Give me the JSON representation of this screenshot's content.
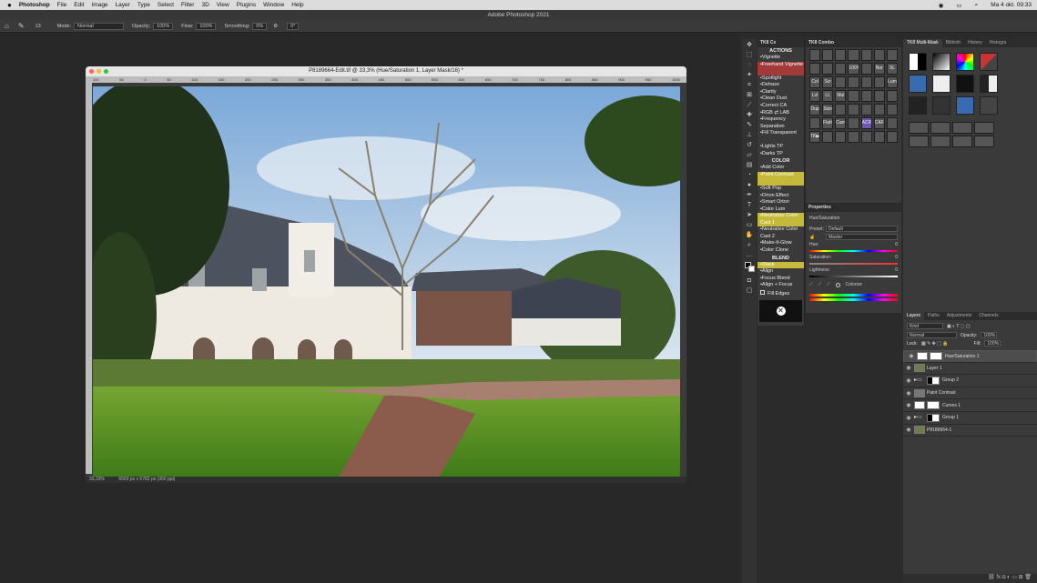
{
  "menubar": {
    "app": "Photoshop",
    "items": [
      "File",
      "Edit",
      "Image",
      "Layer",
      "Type",
      "Select",
      "Filter",
      "3D",
      "View",
      "Plugins",
      "Window",
      "Help"
    ],
    "clock": "Ma 4 okt. 09:33"
  },
  "window_title": "Adobe Photoshop 2021",
  "options": {
    "mode_label": "Mode:",
    "mode": "Normal",
    "opacity_label": "Opacity:",
    "opacity": "100%",
    "flow_label": "Flow:",
    "flow": "100%",
    "smoothing_label": "Smoothing:",
    "smoothing": "0%",
    "angle": "0°",
    "brush_size": "13"
  },
  "document": {
    "title": "P8189664-Edit.tif @ 33,3% (Hue/Saturation 1, Layer Mask/16) *",
    "zoom": "33,33%",
    "info": "6569 px x 5782 px (300 ppi)",
    "ruler": [
      "100",
      "50",
      "0",
      "50",
      "100",
      "150",
      "200",
      "250",
      "300",
      "350",
      "400",
      "450",
      "500",
      "550",
      "600",
      "650",
      "700",
      "750",
      "800",
      "850",
      "900",
      "950",
      "1000"
    ]
  },
  "actions_panel": {
    "tab": "TK8 Cx",
    "sections": [
      {
        "title": "ACTIONS",
        "items": [
          {
            "label": "•Vignette",
            "bg": ""
          },
          {
            "label": "•Freehand Vignette",
            "bg": "#a23a3a"
          },
          {
            "label": "•Spotlight",
            "bg": ""
          },
          {
            "label": "•Dehaze",
            "bg": ""
          },
          {
            "label": "•Clarity",
            "bg": ""
          },
          {
            "label": "•Clean Dust",
            "bg": ""
          },
          {
            "label": "•Correct CA",
            "bg": ""
          },
          {
            "label": "•RGB ⇄ LAB",
            "bg": ""
          },
          {
            "label": "•Frequency Separation",
            "bg": ""
          },
          {
            "label": "•Fill Transparent",
            "bg": ""
          },
          {
            "label": "•Lights TP",
            "bg": ""
          },
          {
            "label": "•Darks TP",
            "bg": ""
          }
        ]
      },
      {
        "title": "COLOR",
        "items": [
          {
            "label": "•Add Color",
            "bg": ""
          },
          {
            "label": "•Paint Contrast",
            "bg": "#c4b93a"
          },
          {
            "label": "•Soft Pop",
            "bg": ""
          },
          {
            "label": "•Orton Effect",
            "bg": ""
          },
          {
            "label": "•Smart Orton",
            "bg": ""
          },
          {
            "label": "•Color Lum",
            "bg": ""
          },
          {
            "label": "•Neutralize Color Cast 1",
            "bg": "#c4b93a"
          },
          {
            "label": "•Neutralize Color Cast 2",
            "bg": ""
          },
          {
            "label": "•Make-It-Glow",
            "bg": ""
          },
          {
            "label": "•Color Clone",
            "bg": ""
          }
        ]
      },
      {
        "title": "BLEND",
        "items": [
          {
            "label": "•Stack",
            "bg": "#c4b93a"
          },
          {
            "label": "•Align",
            "bg": ""
          },
          {
            "label": "•Focus Blend",
            "bg": ""
          },
          {
            "label": "•Align + Focus",
            "bg": ""
          }
        ]
      }
    ],
    "fill_edges": "Fill Edges"
  },
  "combo_panel": {
    "tab": "TK8 Combo",
    "buttons": [
      "",
      "",
      "",
      "",
      "",
      "",
      "",
      "",
      "",
      "",
      "100%",
      "",
      "Nor",
      "SL",
      "Col",
      "Scr",
      "",
      "",
      "",
      "",
      "Lum",
      "Lvl",
      "LL",
      "Mul",
      "",
      "",
      "",
      "",
      "Dup Img",
      "Size",
      "",
      "",
      "",
      "",
      "",
      "",
      "Flatten",
      "Canvas",
      "",
      "ACR",
      "CAF",
      "",
      "TK▶",
      "",
      "",
      "",
      "",
      "",
      ""
    ]
  },
  "properties": {
    "tab": "Properties",
    "type": "Hue/Saturation",
    "preset_label": "Preset:",
    "preset": "Default",
    "channel": "Master",
    "hue_label": "Hue:",
    "hue": "0",
    "sat_label": "Saturation:",
    "sat": "0",
    "light_label": "Lightness:",
    "light": "0",
    "colorize": "Colorize"
  },
  "mask_panel": {
    "tabs": [
      "TK8 Multi-Mask",
      "Biblioth",
      "History",
      "Histogra"
    ]
  },
  "layers_panel": {
    "tabs": [
      "Layers",
      "Paths",
      "Adjustments",
      "Channels"
    ],
    "kind": "Kind",
    "blend": "Normal",
    "opacity_label": "Opacity:",
    "opacity": "100%",
    "lock_label": "Lock:",
    "fill_label": "Fill:",
    "fill": "100%",
    "layers": [
      {
        "name": "Hue/Saturation 1",
        "sel": true
      },
      {
        "name": "Layer 1",
        "sel": false
      },
      {
        "name": "Group 2",
        "sel": false
      },
      {
        "name": "Paint Contrast",
        "sel": false
      },
      {
        "name": "Curves 1",
        "sel": false
      },
      {
        "name": "Group 1",
        "sel": false
      },
      {
        "name": "P8189664-1",
        "sel": false
      }
    ]
  },
  "colors": {
    "accent": "#c4b93a",
    "danger": "#a23a3a",
    "panel": "#3a3a3a"
  }
}
